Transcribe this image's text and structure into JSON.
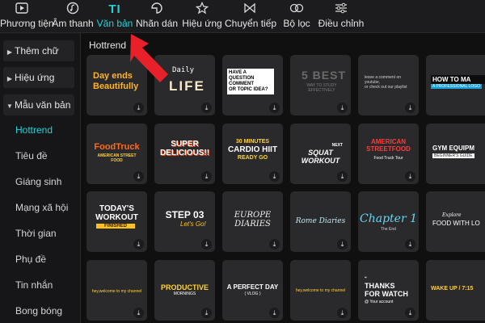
{
  "toolbar": {
    "tabs": [
      {
        "label": "Phương tiện",
        "icon": "media-icon"
      },
      {
        "label": "Âm thanh",
        "icon": "audio-icon"
      },
      {
        "label": "Văn bản",
        "icon": "text-icon",
        "active": true
      },
      {
        "label": "Nhãn dán",
        "icon": "sticker-icon"
      },
      {
        "label": "Hiệu ứng",
        "icon": "effects-icon"
      },
      {
        "label": "Chuyển tiếp",
        "icon": "transition-icon"
      },
      {
        "label": "Bộ lọc",
        "icon": "filter-icon"
      },
      {
        "label": "Điều chỉnh",
        "icon": "adjust-icon"
      }
    ]
  },
  "sidebar": {
    "categories": [
      {
        "label": "Thêm chữ",
        "expanded": false
      },
      {
        "label": "Hiệu ứng",
        "expanded": false
      },
      {
        "label": "Mẫu văn bản",
        "expanded": true
      }
    ],
    "subitems": [
      "Hottrend",
      "Tiêu đề",
      "Giáng sinh",
      "Mạng xã hội",
      "Thời gian",
      "Phụ đề",
      "Tin nhắn",
      "Bong bóng"
    ],
    "active_subitem": "Hottrend"
  },
  "content": {
    "section_title": "Hottrend",
    "cards": [
      {
        "lines": [
          "Day ends",
          "Beautifully"
        ]
      },
      {
        "lines": [
          "Daily",
          "LIFE"
        ]
      },
      {
        "lines": [
          "HAVE A QUESTION",
          "COMMENT",
          "OR TOPIC IDEA?"
        ]
      },
      {
        "lines": [
          "5 BEST",
          "WAY TO STUDY",
          "EFFECTIVELY"
        ]
      },
      {
        "lines": [
          "leave a comment on youtube,",
          "or check out our playlist"
        ]
      },
      {
        "lines": [
          "HOW TO MA",
          "A PROFESSIONAL LOGO"
        ]
      },
      {
        "lines": [
          "FoodTruck",
          "AMERICAN STREET FOOD"
        ]
      },
      {
        "lines": [
          "SUPER",
          "DELICIOUS!!"
        ]
      },
      {
        "lines": [
          "30 MINUTES",
          "CARDIO HIIT",
          "READY GO"
        ]
      },
      {
        "lines": [
          "NEXT",
          "SQUAT WORKOUT"
        ]
      },
      {
        "lines": [
          "AMERICAN",
          "STREETFOOD",
          "Food Truck Tour"
        ]
      },
      {
        "lines": [
          "GYM EQUIPM",
          "BEGINNER'S GUIDE"
        ]
      },
      {
        "lines": [
          "TODAY'S",
          "WORKOUT",
          "FINISHED"
        ]
      },
      {
        "lines": [
          "STEP 03",
          "Let's Go!"
        ]
      },
      {
        "lines": [
          "EUROPE",
          "DIARIES"
        ]
      },
      {
        "lines": [
          "Rome Diaries"
        ]
      },
      {
        "lines": [
          "Chapter 1",
          "The End"
        ]
      },
      {
        "lines": [
          "Explore",
          "FOOD WITH LO"
        ]
      },
      {
        "lines": [
          "hey,welcome to my channel"
        ]
      },
      {
        "lines": [
          "PRODUCTIVE",
          "MORNINGS"
        ]
      },
      {
        "lines": [
          "A PERFECT DAY",
          "( VLOG )"
        ]
      },
      {
        "lines": [
          "hey,welcome to my channel"
        ]
      },
      {
        "lines": [
          "THANKS",
          "FOR WATCH",
          "@ Your account"
        ]
      },
      {
        "lines": [
          "WAKE UP / 7:15"
        ]
      }
    ]
  },
  "colors": {
    "accent": "#22d3d8",
    "arrow": "#e8202a"
  }
}
